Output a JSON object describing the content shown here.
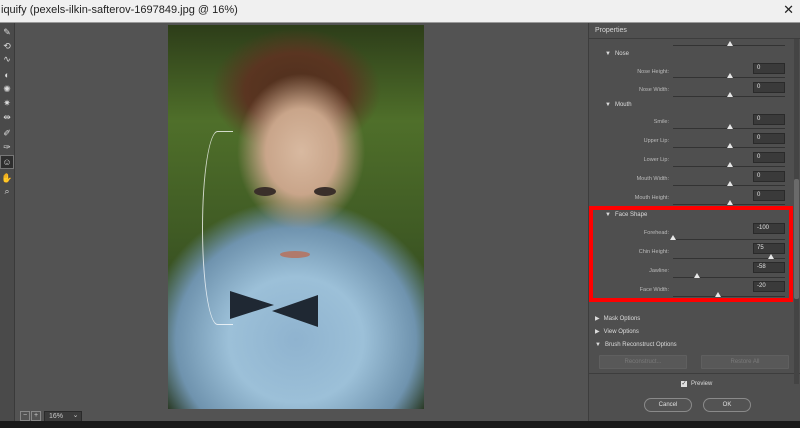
{
  "window": {
    "title": "iquify (pexels-ilkin-safterov-1697849.jpg @ 16%)",
    "close_glyph": "✕"
  },
  "toolbar": {
    "tools": [
      {
        "name": "forward-warp-tool-icon",
        "glyph": "✎"
      },
      {
        "name": "reconstruct-tool-icon",
        "glyph": "⟲"
      },
      {
        "name": "smooth-tool-icon",
        "glyph": "∿"
      },
      {
        "name": "twirl-tool-icon",
        "glyph": "◐"
      },
      {
        "name": "pucker-tool-icon",
        "glyph": "✺"
      },
      {
        "name": "bloat-tool-icon",
        "glyph": "✷"
      },
      {
        "name": "push-left-tool-icon",
        "glyph": "⇹"
      },
      {
        "name": "freeze-mask-tool-icon",
        "glyph": "✐"
      },
      {
        "name": "thaw-mask-tool-icon",
        "glyph": "✑"
      },
      {
        "name": "face-tool-icon",
        "glyph": "☺"
      },
      {
        "name": "hand-tool-icon",
        "glyph": "✋"
      },
      {
        "name": "zoom-tool-icon",
        "glyph": "⌕"
      }
    ]
  },
  "canvas": {
    "zoom_value": "16%",
    "zoom_minus": "−",
    "zoom_plus": "+",
    "zoom_dropdown": "⌄"
  },
  "panel": {
    "title": "Properties",
    "sections": {
      "nose": {
        "label": "Nose"
      },
      "mouth": {
        "label": "Mouth"
      },
      "face_shape": {
        "label": "Face Shape"
      },
      "mask_options": {
        "label": "Mask Options"
      },
      "view_options": {
        "label": "View Options"
      },
      "brush_reconstruct": {
        "label": "Brush Reconstruct Options"
      }
    },
    "sliders": {
      "nose_height": {
        "label": "Nose Height:",
        "value": "0"
      },
      "nose_width": {
        "label": "Nose Width:",
        "value": "0"
      },
      "smile": {
        "label": "Smile:",
        "value": "0"
      },
      "upper_lip": {
        "label": "Upper Lip:",
        "value": "0"
      },
      "lower_lip": {
        "label": "Lower Lip:",
        "value": "0"
      },
      "mouth_width": {
        "label": "Mouth Width:",
        "value": "0"
      },
      "mouth_height": {
        "label": "Mouth Height:",
        "value": "0"
      },
      "forehead": {
        "label": "Forehead:",
        "value": "-100"
      },
      "chin_height": {
        "label": "Chin Height:",
        "value": "75"
      },
      "jawline": {
        "label": "Jawline:",
        "value": "-58"
      },
      "face_width": {
        "label": "Face Width:",
        "value": "-20"
      }
    },
    "buttons": {
      "reconstruct": "Reconstruct...",
      "restore_all": "Restore All"
    },
    "preview": {
      "label": "Preview",
      "checked": true,
      "check_glyph": "✓"
    },
    "cancel": "Cancel",
    "ok": "OK"
  },
  "triangles": {
    "open": "▼",
    "closed": "▶"
  },
  "colors": {
    "highlight": "#ff0000"
  }
}
